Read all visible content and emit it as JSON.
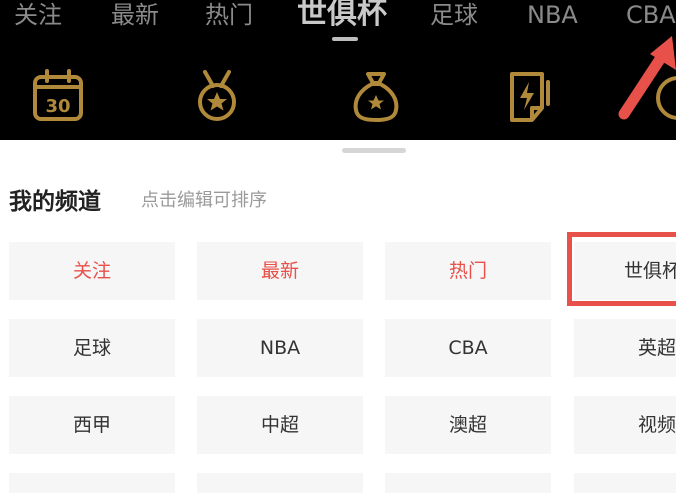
{
  "tabs": [
    {
      "label": "关注"
    },
    {
      "label": "最新"
    },
    {
      "label": "热门"
    },
    {
      "label": "世俱杯"
    },
    {
      "label": "足球"
    },
    {
      "label": "NBA"
    },
    {
      "label": "CBA"
    }
  ],
  "active_tab": "世俱杯",
  "icons": [
    "calendar-30-icon",
    "medal-icon",
    "money-bag-icon",
    "lightning-card-icon",
    "partial-icon"
  ],
  "calendar_day": "30",
  "panel": {
    "title": "我的频道",
    "hint": "点击编辑可排序"
  },
  "channels": [
    {
      "label": "关注",
      "fixed": true
    },
    {
      "label": "最新",
      "fixed": true
    },
    {
      "label": "热门",
      "fixed": true
    },
    {
      "label": "世俱杯",
      "fixed": false
    },
    {
      "label": "足球",
      "fixed": false
    },
    {
      "label": "NBA",
      "fixed": false
    },
    {
      "label": "CBA",
      "fixed": false
    },
    {
      "label": "英超",
      "fixed": false
    },
    {
      "label": "西甲",
      "fixed": false
    },
    {
      "label": "中超",
      "fixed": false
    },
    {
      "label": "澳超",
      "fixed": false
    },
    {
      "label": "视频",
      "fixed": false
    }
  ],
  "colors": {
    "header_bg": "#000000",
    "icon_gold": "#b08a3a",
    "accent_red": "#e8504a",
    "tile_bg": "#f6f6f6"
  }
}
